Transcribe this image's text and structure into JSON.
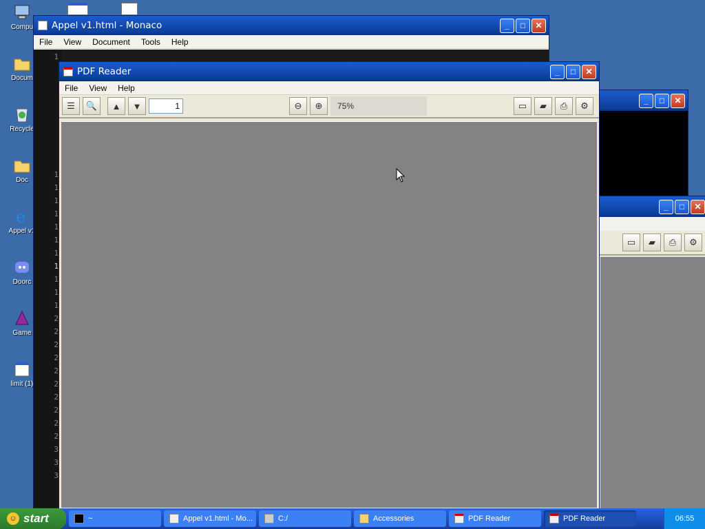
{
  "desktop": {
    "icons": [
      {
        "label": "Compu",
        "icon": "computer-icon"
      },
      {
        "label": "Docum",
        "icon": "folder-icon"
      },
      {
        "label": "Recycle",
        "icon": "recycle-bin-icon"
      },
      {
        "label": "Doc",
        "icon": "folder-icon"
      },
      {
        "label": "Appel v1",
        "icon": "internet-explorer-icon"
      },
      {
        "label": "Doorc",
        "icon": "discord-icon"
      },
      {
        "label": "Game",
        "icon": "game-icon"
      },
      {
        "label": "limit (1)",
        "icon": "window-icon"
      }
    ]
  },
  "monaco": {
    "title": "Appel v1.html - Monaco",
    "menu": [
      "File",
      "View",
      "Document",
      "Tools",
      "Help"
    ],
    "line_numbers": [
      "1",
      "1",
      "1",
      "1",
      "1",
      "1",
      "1",
      "1",
      "1",
      "1",
      "1",
      "2",
      "2",
      "2",
      "2",
      "2",
      "2",
      "2",
      "2",
      "2",
      "2",
      "3",
      "3",
      "3",
      "3"
    ]
  },
  "pdf": {
    "title": "PDF Reader",
    "menu": [
      "File",
      "View",
      "Help"
    ],
    "page_number": "1",
    "zoom": "75%"
  },
  "taskbar": {
    "start_label": "start",
    "tasks": [
      {
        "label": "~",
        "active": false
      },
      {
        "label": "Appel v1.html - Mo...",
        "active": false
      },
      {
        "label": "C:/",
        "active": false
      },
      {
        "label": "Accessories",
        "active": false
      },
      {
        "label": "PDF Reader",
        "active": false
      },
      {
        "label": "PDF Reader",
        "active": true
      }
    ],
    "clock": "06:55"
  }
}
